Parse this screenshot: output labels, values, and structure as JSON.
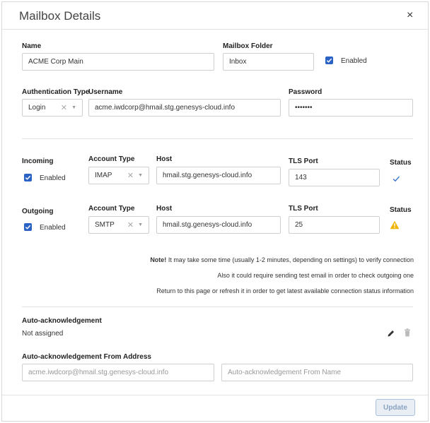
{
  "dialog": {
    "title": "Mailbox Details",
    "close_label": "×"
  },
  "general": {
    "name_label": "Name",
    "name_value": "ACME Corp Main",
    "folder_label": "Mailbox Folder",
    "folder_value": "Inbox",
    "enabled_label": "Enabled"
  },
  "auth": {
    "type_label": "Authentication Type",
    "type_value": "Login",
    "username_label": "Username",
    "username_value": "acme.iwdcorp@hmail.stg.genesys-cloud.info",
    "password_label": "Password",
    "password_value": "•••••••"
  },
  "incoming": {
    "section_label": "Incoming",
    "enabled_label": "Enabled",
    "account_type_label": "Account Type",
    "account_type_value": "IMAP",
    "host_label": "Host",
    "host_value": "hmail.stg.genesys-cloud.info",
    "tls_label": "TLS Port",
    "tls_value": "143",
    "status_label": "Status",
    "status_icon": "check-icon",
    "status_color": "#3a78c9"
  },
  "outgoing": {
    "section_label": "Outgoing",
    "enabled_label": "Enabled",
    "account_type_label": "Account Type",
    "account_type_value": "SMTP",
    "host_label": "Host",
    "host_value": "hmail.stg.genesys-cloud.info",
    "tls_label": "TLS Port",
    "tls_value": "25",
    "status_label": "Status",
    "status_icon": "warning-icon",
    "status_color": "#f0b400"
  },
  "notes": {
    "note_prefix": "Note!",
    "line1": " It may take some time (usually 1-2 minutes, depending on settings) to verify connection",
    "line2": "Also it could require sending test email in order to check outgoing one",
    "line3": "Return to this page or refresh it in order to get latest available connection status information"
  },
  "auto_ack": {
    "label": "Auto-acknowledgement",
    "value": "Not assigned",
    "from_label": "Auto-acknowledgement From Address",
    "from_address_placeholder": "acme.iwdcorp@hmail.stg.genesys-cloud.info",
    "from_name_placeholder": "Auto-acknowledgement From Name"
  },
  "footer": {
    "update_label": "Update"
  },
  "colors": {
    "checkbox": "#2b63c5",
    "button_text": "#8aa3c2"
  }
}
